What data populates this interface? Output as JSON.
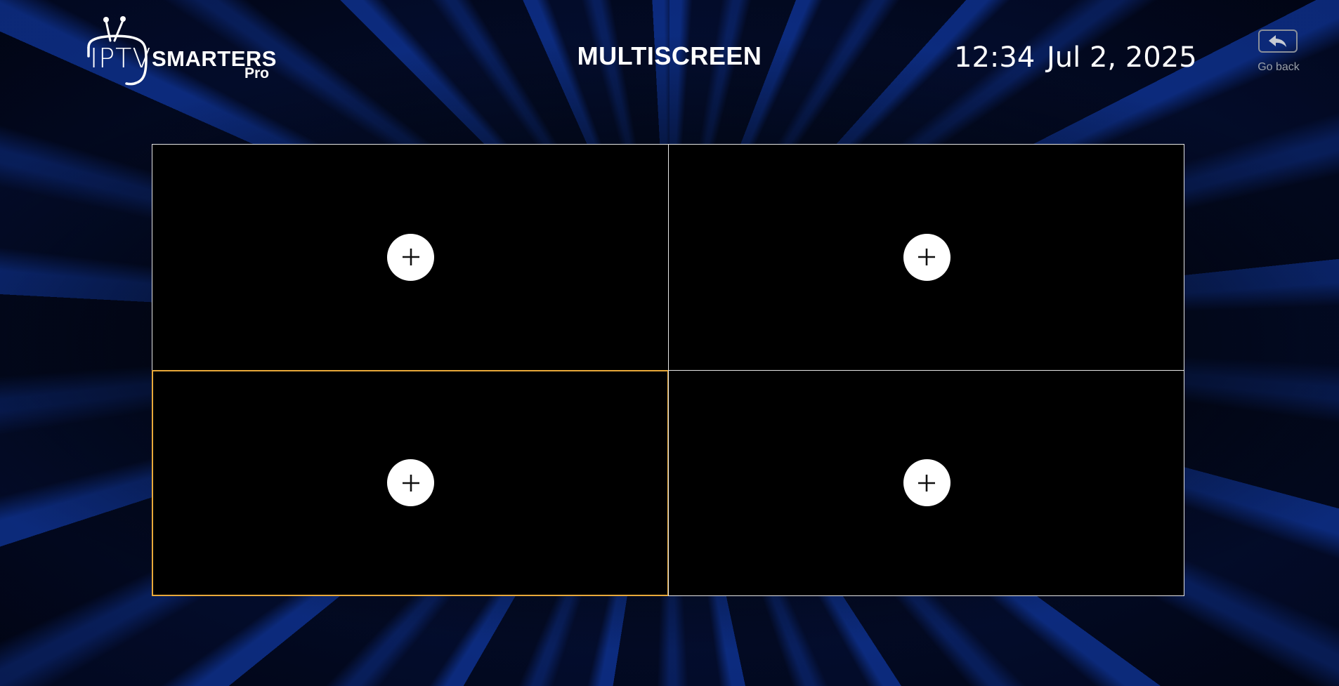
{
  "logo": {
    "iptv": "IPTV",
    "smarters": "SMARTERS",
    "pro": "Pro"
  },
  "header": {
    "title": "MULTISCREEN",
    "time": "12:34",
    "date": "Jul 2, 2025",
    "go_back_label": "Go back",
    "go_back_icon": "reply-arrow-icon"
  },
  "slots": [
    {
      "id": 1,
      "icon": "plus-icon",
      "selected": false
    },
    {
      "id": 2,
      "icon": "plus-icon",
      "selected": false
    },
    {
      "id": 3,
      "icon": "plus-icon",
      "selected": true
    },
    {
      "id": 4,
      "icon": "plus-icon",
      "selected": false
    }
  ],
  "colors": {
    "accent": "#e8a93a",
    "slot_border": "#e6e6e6",
    "background": "#030b26"
  }
}
